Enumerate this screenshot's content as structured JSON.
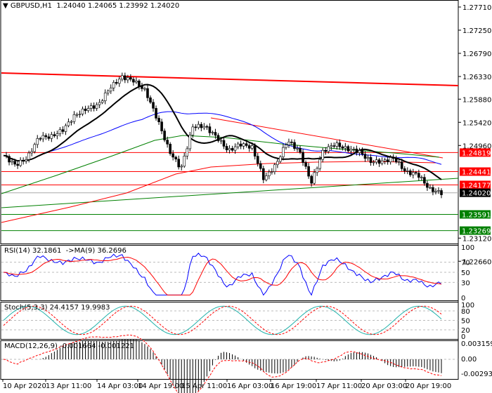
{
  "header": {
    "symbol": "GBPUSD,H1",
    "ohlc": "1.24040 1.24065 1.23992 1.24020"
  },
  "rsi_label": "RSI(14) 32.1861  ->MA(9) 36.2696",
  "stoch_label": "Stoch(5,3,3) 24.4157 19.9983",
  "macd_label": "MACD(12,26,9) -0.001664 -0.001221",
  "colors": {
    "bull": "#008000",
    "bear": "#ff0000",
    "ma20": "#000000",
    "ma50": "#0000ff",
    "rsi": "#0000ff",
    "stoch": "#20b2aa"
  },
  "chart_data": {
    "type": "candlestick",
    "title": "GBPUSD,H1",
    "ylim": [
      1.2266,
      1.2771
    ],
    "price_ticks": [
      "1.27710",
      "1.27250",
      "1.26790",
      "1.26330",
      "1.25880",
      "1.25420",
      "1.24960",
      "1.23120",
      "1.22660"
    ],
    "price_badges": [
      {
        "value": "1.24819",
        "color": "#ff0000"
      },
      {
        "value": "1.24441",
        "color": "#ff0000"
      },
      {
        "value": "1.24177",
        "color": "#ff0000"
      },
      {
        "value": "1.24020",
        "color": "#000000"
      },
      {
        "value": "1.23591",
        "color": "#008000"
      },
      {
        "value": "1.23269",
        "color": "#008000"
      }
    ],
    "x_labels": [
      "10 Apr 2020",
      "13 Apr 11:00",
      "14 Apr 03:00",
      "14 Apr 19:00",
      "15 Apr 11:00",
      "16 Apr 03:00",
      "16 Apr 19:00",
      "17 Apr 11:00",
      "20 Apr 03:00",
      "20 Apr 19:00"
    ],
    "close_path": [
      1.2476,
      1.2457,
      1.2471,
      1.2513,
      1.2513,
      1.2527,
      1.2555,
      1.2569,
      1.2576,
      1.2611,
      1.2632,
      1.2625,
      1.2604,
      1.2548,
      1.2485,
      1.245,
      1.2534,
      1.2534,
      1.2513,
      1.2485,
      1.2499,
      1.2492,
      1.2429,
      1.2457,
      1.2506,
      1.2485,
      1.2422,
      1.2485,
      1.2499,
      1.2489,
      1.2485,
      1.2464,
      1.2464,
      1.2471,
      1.2443,
      1.2439,
      1.2409,
      1.2402
    ],
    "rsi_ticks": [
      "100",
      "70",
      "50",
      "30",
      "0"
    ],
    "stoch_ticks": [
      "100",
      "80",
      "50",
      "20",
      "0"
    ],
    "macd_ticks": [
      "0.003159",
      "0.00",
      "-0.002938"
    ]
  }
}
